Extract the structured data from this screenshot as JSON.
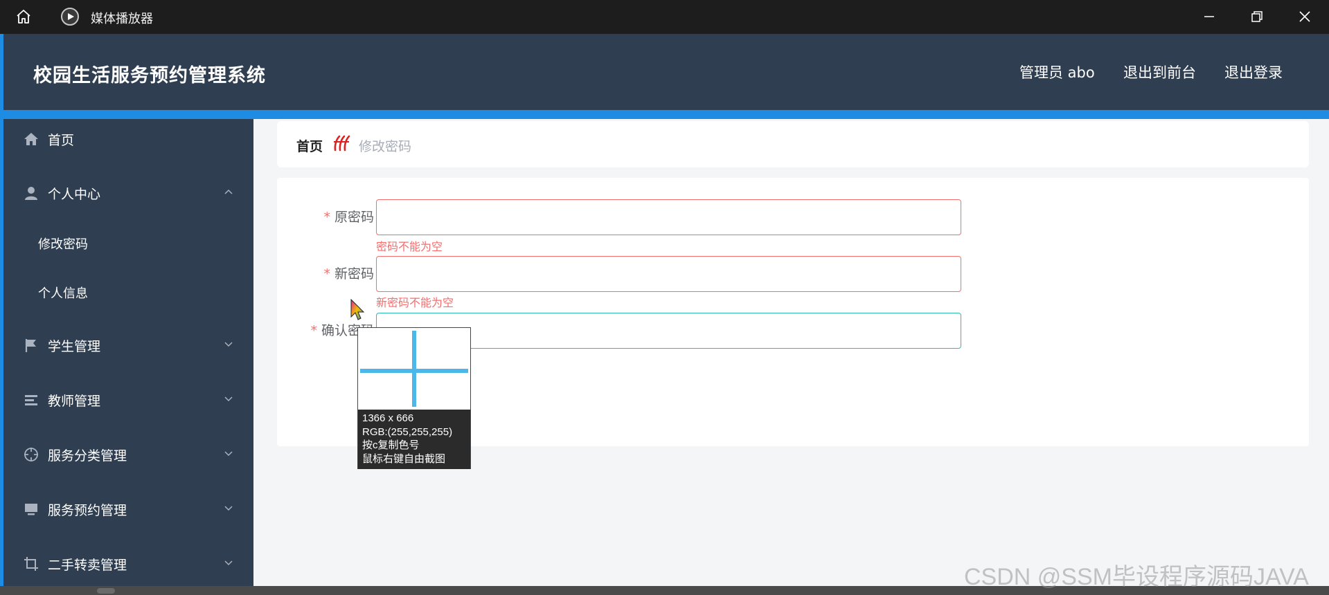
{
  "window": {
    "app_name": "媒体播放器",
    "icons": {
      "home": "home-icon",
      "app": "media-player-icon",
      "minimize": "minimize-icon",
      "restore": "restore-icon",
      "close": "close-icon"
    }
  },
  "header": {
    "title": "校园生活服务预约管理系统",
    "user": "管理员 abo",
    "front": "退出到前台",
    "logout": "退出登录"
  },
  "sidebar": {
    "items": [
      {
        "label": "首页",
        "icon": "home-icon"
      },
      {
        "label": "个人中心",
        "icon": "user-icon",
        "expanded": true
      },
      {
        "label": "修改密码"
      },
      {
        "label": "个人信息"
      },
      {
        "label": "学生管理",
        "icon": "flag-icon"
      },
      {
        "label": "教师管理",
        "icon": "list-icon"
      },
      {
        "label": "服务分类管理",
        "icon": "target-icon"
      },
      {
        "label": "服务预约管理",
        "icon": "monitor-icon"
      },
      {
        "label": "二手转卖管理",
        "icon": "crop-icon"
      }
    ]
  },
  "breadcrumb": {
    "home": "首页",
    "current": "修改密码"
  },
  "form": {
    "old_password": {
      "label": "原密码",
      "value": "",
      "error": "密码不能为空"
    },
    "new_password": {
      "label": "新密码",
      "value": "",
      "error": "新密码不能为空"
    },
    "confirm_password": {
      "label": "确认密码",
      "value": ""
    }
  },
  "magnifier": {
    "size": "1366 x 666",
    "rgb": "RGB:(255,255,255)",
    "hint1": "按c复制色号",
    "hint2": "鼠标右键自由截图"
  },
  "watermark": "CSDN @SSM毕设程序源码JAVA",
  "colors": {
    "header_bg": "#2f3e50",
    "accent_blue": "#1e8ce3",
    "error": "#f56c6c",
    "focus": "#2bbbad"
  }
}
